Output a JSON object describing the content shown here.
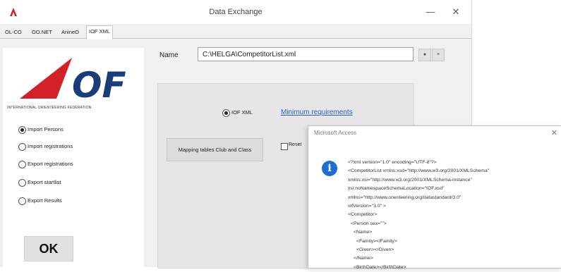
{
  "window": {
    "title": "Data Exchange",
    "minimize": "—",
    "close": "✕"
  },
  "tabs": [
    "OL-CO",
    "OO.NET",
    "AnineO",
    "IOF XML"
  ],
  "active_tab": 3,
  "logo": {
    "letters": "OF",
    "subtitle": "INTERNATIONAL ORIENTEERING FEDERATION"
  },
  "options": [
    {
      "label": "Import Persons",
      "selected": true
    },
    {
      "label": "Import registrations",
      "selected": false
    },
    {
      "label": "Export registrations",
      "selected": false
    },
    {
      "label": "Export startlist",
      "selected": false
    },
    {
      "label": "Export Results",
      "selected": false
    }
  ],
  "ok_label": "OK",
  "name": {
    "label": "Name",
    "value": "C:\\HELGA\\CompetitorList.xml",
    "browse": "●",
    "clear": "×"
  },
  "format_option": "IOF XML",
  "min_requirements": "Minimum requirements",
  "mapping_button": "Mapping tables Club and Class",
  "reset_label": "Reset",
  "dialog": {
    "title": "Microsoft Access",
    "close": "✕",
    "info_icon": "i",
    "lines": [
      "<?xml version=\"1.0\" encoding=\"UTF-8\"?>",
      "<CompetitorList xmlns:xsd=\"http://www.w3.org/2001/XMLSchema\"",
      "xmlns:xsi=\"http://www.w3.org/2001/XMLSchema-instance\"",
      "xsi:noNamespaceSchemaLocation=\"IOF.xsd\"",
      "xmlns=\"http://www.orienteering.org/datastandard/3.0\"",
      "iofVersion=\"3.0\" >",
      "<Competitor>",
      " <Person sex=\"\">",
      "  <Name>",
      "   <Family></Family>",
      "   <Given></Given>",
      "  </Name>",
      "  <BirthDate></BirthDate>"
    ]
  },
  "colors": {
    "logo_red": "#d42027",
    "logo_navy": "#1a3d7a",
    "link": "#2a5fb8",
    "info": "#1f6fd1"
  }
}
